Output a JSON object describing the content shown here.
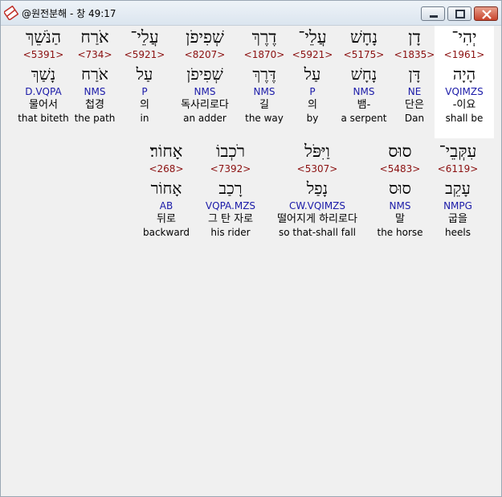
{
  "window": {
    "title": "@원전분해 - 창 49:17"
  },
  "rows": [
    [
      {
        "hebrew": "יְהִי־",
        "strong": "<1961>",
        "lemma": "הָיָה",
        "morph": "VQIMZS",
        "korean": "-이요",
        "english": "shall be",
        "selected": true
      },
      {
        "hebrew": "דָן",
        "strong": "<1835>",
        "lemma": "דָּן",
        "morph": "NE",
        "korean": "단은",
        "english": "Dan"
      },
      {
        "hebrew": "נָחָשׁ",
        "strong": "<5175>",
        "lemma": "נָחָשׁ",
        "morph": "NMS",
        "korean": "뱀-",
        "english": "a serpent"
      },
      {
        "hebrew": "עֲלֵי־",
        "strong": "<5921>",
        "lemma": "עַל",
        "morph": "P",
        "korean": "의",
        "english": "by"
      },
      {
        "hebrew": "דֶרֶךְ",
        "strong": "<1870>",
        "lemma": "דֶּרֶךְ",
        "morph": "NMS",
        "korean": "길",
        "english": "the way"
      },
      {
        "hebrew": "שְׁפִיפֹן",
        "strong": "<8207>",
        "lemma": "שְׁפִיפֹן",
        "morph": "NMS",
        "korean": "독사리로다",
        "english": "an adder"
      },
      {
        "hebrew": "עֲלֵי־",
        "strong": "<5921>",
        "lemma": "עַל",
        "morph": "P",
        "korean": "의",
        "english": "in"
      },
      {
        "hebrew": "אֹרַח",
        "strong": "<734>",
        "lemma": "אֹרַח",
        "morph": "NMS",
        "korean": "첩경",
        "english": "the path"
      },
      {
        "hebrew": "הַנֹּשֵׁךְ",
        "strong": "<5391>",
        "lemma": "נָשַׁךְ",
        "morph": "D.VQPA",
        "korean": "물어서",
        "english": "that biteth"
      }
    ],
    [
      {
        "hebrew": "עִקְּבֵי־",
        "strong": "<6119>",
        "lemma": "עָקֵב",
        "morph": "NMPG",
        "korean": "굽을",
        "english": "heels"
      },
      {
        "hebrew": "סוּס",
        "strong": "<5483>",
        "lemma": "סוּס",
        "morph": "NMS",
        "korean": "말",
        "english": "the horse"
      },
      {
        "hebrew": "וַיִּפֹּל",
        "strong": "<5307>",
        "lemma": "נָפַל",
        "morph": "CW.VQIMZS",
        "korean": "떨어지게 하리로다",
        "english": "so that-shall fall"
      },
      {
        "hebrew": "רֹכְבוֹ",
        "strong": "<7392>",
        "lemma": "רָכַב",
        "morph": "VQPA.MZS",
        "korean": "그 탄 자로",
        "english": "his rider"
      },
      {
        "hebrew": "אָחוֹר׃",
        "strong": "<268>",
        "lemma": "אָחוֹר",
        "morph": "AB",
        "korean": "뒤로",
        "english": "backward"
      }
    ]
  ]
}
